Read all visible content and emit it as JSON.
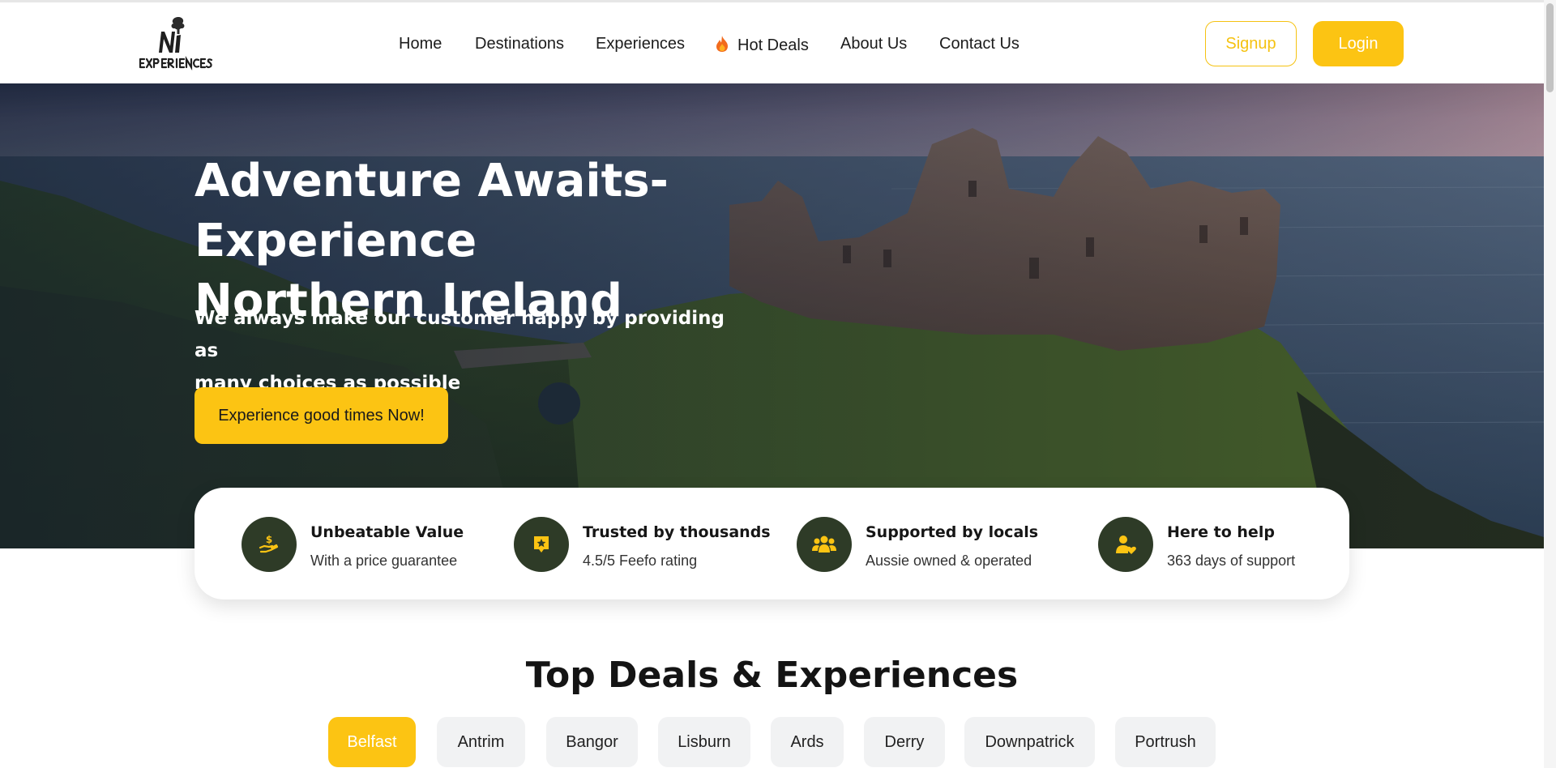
{
  "colors": {
    "accent": "#fcc413",
    "feature_icon_bg": "#2e3b27",
    "pill_bg": "#f1f2f3"
  },
  "header": {
    "logo_alt": "NI Experiences",
    "nav": [
      {
        "label": "Home"
      },
      {
        "label": "Destinations"
      },
      {
        "label": "Experiences"
      },
      {
        "label": "Hot Deals",
        "icon": "fire-icon"
      },
      {
        "label": "About Us"
      },
      {
        "label": "Contact Us"
      }
    ],
    "signup_label": "Signup",
    "login_label": "Login"
  },
  "hero": {
    "title_line1": "Adventure Awaits-Experience",
    "title_line2": "Northern Ireland",
    "subtitle_line1": "We always make our customer happy by providing as",
    "subtitle_line2": "many choices as possible",
    "cta_label": "Experience good times Now!"
  },
  "features": [
    {
      "icon": "money-hand-icon",
      "title": "Unbeatable Value",
      "text": "With a price guarantee"
    },
    {
      "icon": "star-badge-icon",
      "title": "Trusted by thousands",
      "text": "4.5/5 Feefo rating"
    },
    {
      "icon": "people-group-icon",
      "title": "Supported by locals",
      "text": "Aussie owned & operated"
    },
    {
      "icon": "user-heart-icon",
      "title": "Here to help",
      "text": "363 days of support"
    }
  ],
  "deals": {
    "title": "Top Deals & Experiences",
    "locations": [
      "Belfast",
      "Antrim",
      "Bangor",
      "Lisburn",
      "Ards",
      "Derry",
      "Downpatrick",
      "Portrush"
    ],
    "active": "Belfast"
  }
}
